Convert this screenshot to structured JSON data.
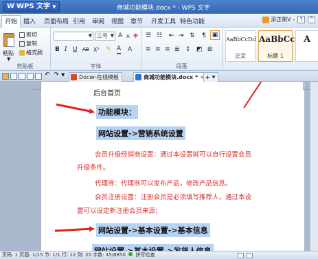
{
  "app": {
    "menu_label": "WPS 文字",
    "window_title": "商城功能模块.docx * - WPS 文字"
  },
  "menu_tabs": [
    "开始",
    "插入",
    "页面布局",
    "引用",
    "审阅",
    "视图",
    "章节",
    "开发工具",
    "特色功能"
  ],
  "menu_right": {
    "share_label": "添正跳V -"
  },
  "ribbon": {
    "clipboard": {
      "paste": "粘贴",
      "cut": "剪切",
      "copy": "复制",
      "format_painter": "格式刷",
      "group_label": "剪贴板"
    },
    "font": {
      "font_name": "",
      "font_size": "三号",
      "grow": "A",
      "shrink": "A",
      "bold": "B",
      "italic": "I",
      "underline": "U",
      "strike": "AB",
      "superscript": "X²",
      "font_color": "A",
      "group_label": "字体"
    },
    "paragraph": {
      "group_label": "段落"
    },
    "styles": [
      {
        "sample": "AaBbCcDd",
        "name": "正文"
      },
      {
        "sample": "AaBbCc",
        "name": "标题 1"
      },
      {
        "sample": "A",
        "name": ""
      }
    ]
  },
  "tabs": [
    {
      "label": "Docer-在线模板",
      "color": "#e0412f"
    },
    {
      "label": "商城功能模块.docx *",
      "color": "#2e74c9"
    }
  ],
  "tab_new": "+",
  "document": {
    "header": "后台首页",
    "heading1": "功能模块：",
    "heading2": "网站设置->营销系统设置",
    "para1_line1": "会员升级经销商设置：通过本设置就可以自行设置会员",
    "para1_line2": "升级条件。",
    "para2": "代理商：代理商可以发布产品，修改产品信息。",
    "para3_line1": "会员注册设置：注册会员是必须填写推荐人，通过本设",
    "para3_line2": "置可以设定新注册会员来源；",
    "heading3": "网站设置->基本设置->基本信息",
    "heading4": "网站设置->基本设置->发货人信息"
  },
  "status": {
    "text": "页码: 1   页面: 1/15   节: 1/1   行: 12   列: 25   字数: 45/6850",
    "spell": "拼写检查"
  },
  "colors": {
    "arrow": "#e02020",
    "highlight": "#b8d2f2",
    "red_text": "#d8302a"
  }
}
